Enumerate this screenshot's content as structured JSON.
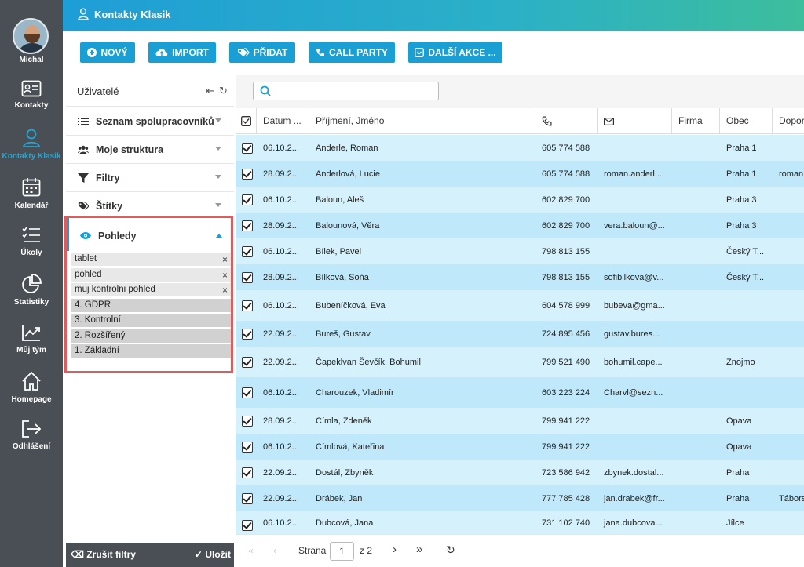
{
  "user": {
    "name": "Michal"
  },
  "nav": [
    {
      "label": "Kontakty",
      "icon": "contact-card-icon"
    },
    {
      "label": "Kontakty Klasik",
      "icon": "person-icon"
    },
    {
      "label": "Kalendář",
      "icon": "calendar-icon"
    },
    {
      "label": "Úkoly",
      "icon": "checklist-icon"
    },
    {
      "label": "Statistiky",
      "icon": "pie-chart-icon"
    },
    {
      "label": "Můj tým",
      "icon": "trend-chart-icon"
    },
    {
      "label": "Homepage",
      "icon": "home-icon"
    },
    {
      "label": "Odhlášení",
      "icon": "logout-icon"
    }
  ],
  "topbar": {
    "title": "Kontakty Klasik"
  },
  "toolbar": {
    "buttons": [
      {
        "label": "NOVÝ",
        "icon": "plus-circle-icon"
      },
      {
        "label": "IMPORT",
        "icon": "cloud-upload-icon"
      },
      {
        "label": "PŘIDAT",
        "icon": "tags-icon"
      },
      {
        "label": "CALL PARTY",
        "icon": "phone-icon"
      },
      {
        "label": "DALŠÍ AKCE ...",
        "icon": "dropdown-box-icon"
      }
    ]
  },
  "leftpanel": {
    "title": "Uživatelé",
    "sections": [
      {
        "label": "Seznam spolupracovníků",
        "icon": "list-icon"
      },
      {
        "label": "Moje struktura",
        "icon": "users-icon"
      },
      {
        "label": "Filtry",
        "icon": "filter-icon"
      },
      {
        "label": "Štítky",
        "icon": "tags-icon"
      }
    ],
    "views_title": "Pohledy",
    "views": [
      {
        "label": "tablet",
        "removable": true
      },
      {
        "label": "pohled",
        "removable": true
      },
      {
        "label": "muj kontrolni pohled",
        "removable": true
      },
      {
        "label": "4. GDPR",
        "removable": false
      },
      {
        "label": "3. Kontrolní",
        "removable": false
      },
      {
        "label": "2. Rozšířený",
        "removable": false
      },
      {
        "label": "1. Základní",
        "removable": false
      }
    ],
    "footer": {
      "clear": "Zrušit filtry",
      "save": "Uložit"
    }
  },
  "grid": {
    "columns": [
      "Datum ...",
      "Příjmení, Jméno",
      "",
      "",
      "Firma",
      "Obec",
      "Dopor"
    ],
    "rows": [
      {
        "date": "06.10.2...",
        "name": "Anderle, Roman",
        "phone": "605 774 588",
        "email": "",
        "firma": "",
        "obec": "Praha 1",
        "dopor": ""
      },
      {
        "date": "28.09.2...",
        "name": "Anderlová, Lucie",
        "phone": "605 774 588",
        "email": "roman.anderl...",
        "firma": "",
        "obec": "Praha 1",
        "dopor": "roman."
      },
      {
        "date": "06.10.2...",
        "name": "Baloun, Aleš",
        "phone": "602 829 700",
        "email": "",
        "firma": "",
        "obec": "Praha 3",
        "dopor": ""
      },
      {
        "date": "28.09.2...",
        "name": "Balounová, Věra",
        "phone": "602 829 700",
        "email": "vera.baloun@...",
        "firma": "",
        "obec": "Praha 3",
        "dopor": ""
      },
      {
        "date": "06.10.2...",
        "name": "Bílek, Pavel",
        "phone": "798 813 155",
        "email": "",
        "firma": "",
        "obec": "Český T...",
        "dopor": ""
      },
      {
        "date": "28.09.2...",
        "name": "Bílková, Soňa",
        "phone": "798 813 155",
        "email": "sofibilkova@v...",
        "firma": "",
        "obec": "Český T...",
        "dopor": ""
      },
      {
        "date": "06.10.2...",
        "name": "Bubeníčková, Eva",
        "phone": "604 578 999",
        "email": "bubeva@gma...",
        "firma": "",
        "obec": "",
        "dopor": ""
      },
      {
        "date": "22.09.2...",
        "name": "Bureš, Gustav",
        "phone": "724 895 456",
        "email": "gustav.bures...",
        "firma": "",
        "obec": "",
        "dopor": ""
      },
      {
        "date": "22.09.2...",
        "name": "Čapeklvan Ševčík, Bohumil",
        "phone": "799 521 490",
        "email": "bohumil.cape...",
        "firma": "",
        "obec": "Znojmo",
        "dopor": ""
      },
      {
        "date": "06.10.2...",
        "name": "Charouzek, Vladimír",
        "phone": "603 223 224",
        "email": "Charvl@sezn...",
        "firma": "",
        "obec": "",
        "dopor": ""
      },
      {
        "date": "28.09.2...",
        "name": "Címla, Zdeněk",
        "phone": "799 941 222",
        "email": "",
        "firma": "",
        "obec": "Opava",
        "dopor": ""
      },
      {
        "date": "06.10.2...",
        "name": "Címlová, Kateřina",
        "phone": "799 941 222",
        "email": "",
        "firma": "",
        "obec": "Opava",
        "dopor": ""
      },
      {
        "date": "22.09.2...",
        "name": "Dostál, Zbyněk",
        "phone": "723 586 942",
        "email": "zbynek.dostal...",
        "firma": "",
        "obec": "Praha",
        "dopor": ""
      },
      {
        "date": "22.09.2...",
        "name": "Drábek, Jan",
        "phone": "777 785 428",
        "email": "jan.drabek@fr...",
        "firma": "",
        "obec": "Praha",
        "dopor": "Tábors"
      },
      {
        "date": "06.10.2...",
        "name": "Dubcová, Jana",
        "phone": "731 102 740",
        "email": "jana.dubcova...",
        "firma": "",
        "obec": "Jílce",
        "dopor": ""
      }
    ]
  },
  "pager": {
    "label": "Strana",
    "page": "1",
    "of": "z 2"
  },
  "colors": {
    "sidebar": "#4a4f55",
    "accent": "#1a9fd4",
    "row_light": "#d4f1fc",
    "row_dark": "#bfe9fa",
    "highlight": "#e05b5b"
  }
}
